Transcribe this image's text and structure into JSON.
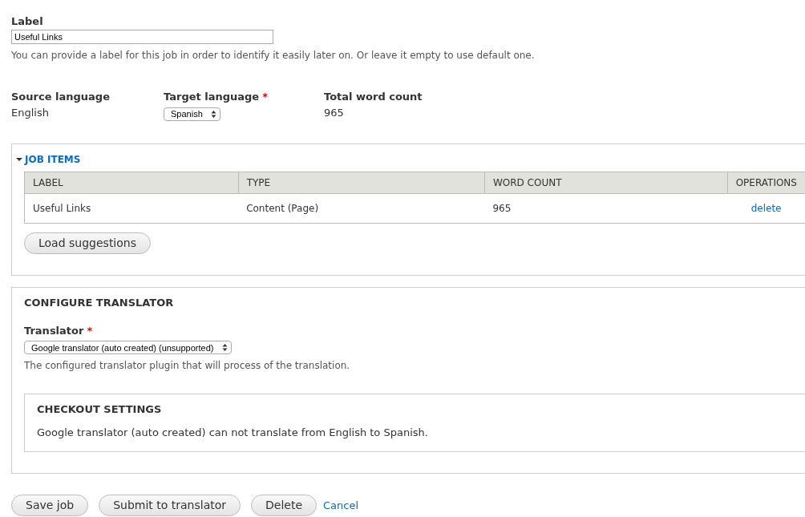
{
  "label_field": {
    "label": "Label",
    "value": "Useful Links",
    "description": "You can provide a label for this job in order to identify it easily later on. Or leave it empty to use default one."
  },
  "languages": {
    "source": {
      "label": "Source language",
      "value": "English"
    },
    "target": {
      "label": "Target language",
      "required_mark": "*",
      "value": "Spanish"
    },
    "word_count": {
      "label": "Total word count",
      "value": "965"
    }
  },
  "job_items": {
    "title": "JOB ITEMS",
    "expanded": true,
    "table": {
      "columns": [
        "LABEL",
        "TYPE",
        "WORD COUNT",
        "OPERATIONS"
      ],
      "rows": [
        {
          "label": "Useful Links",
          "type": "Content (Page)",
          "word_count": "965",
          "operation": "delete"
        }
      ]
    },
    "button": "Load suggestions"
  },
  "configure_translator": {
    "title": "CONFIGURE TRANSLATOR",
    "translator": {
      "label": "Translator",
      "required_mark": "*",
      "value": "Google translator (auto created) (unsupported)",
      "description": "The configured translator plugin that will process of the translation."
    },
    "checkout": {
      "title": "CHECKOUT SETTINGS",
      "message": "Google translator (auto created) can not translate from English to Spanish."
    }
  },
  "actions": [
    {
      "kind": "button",
      "label": "Save job"
    },
    {
      "kind": "button",
      "label": "Submit to translator"
    },
    {
      "kind": "button",
      "label": "Delete"
    },
    {
      "kind": "link",
      "label": "Cancel"
    }
  ]
}
